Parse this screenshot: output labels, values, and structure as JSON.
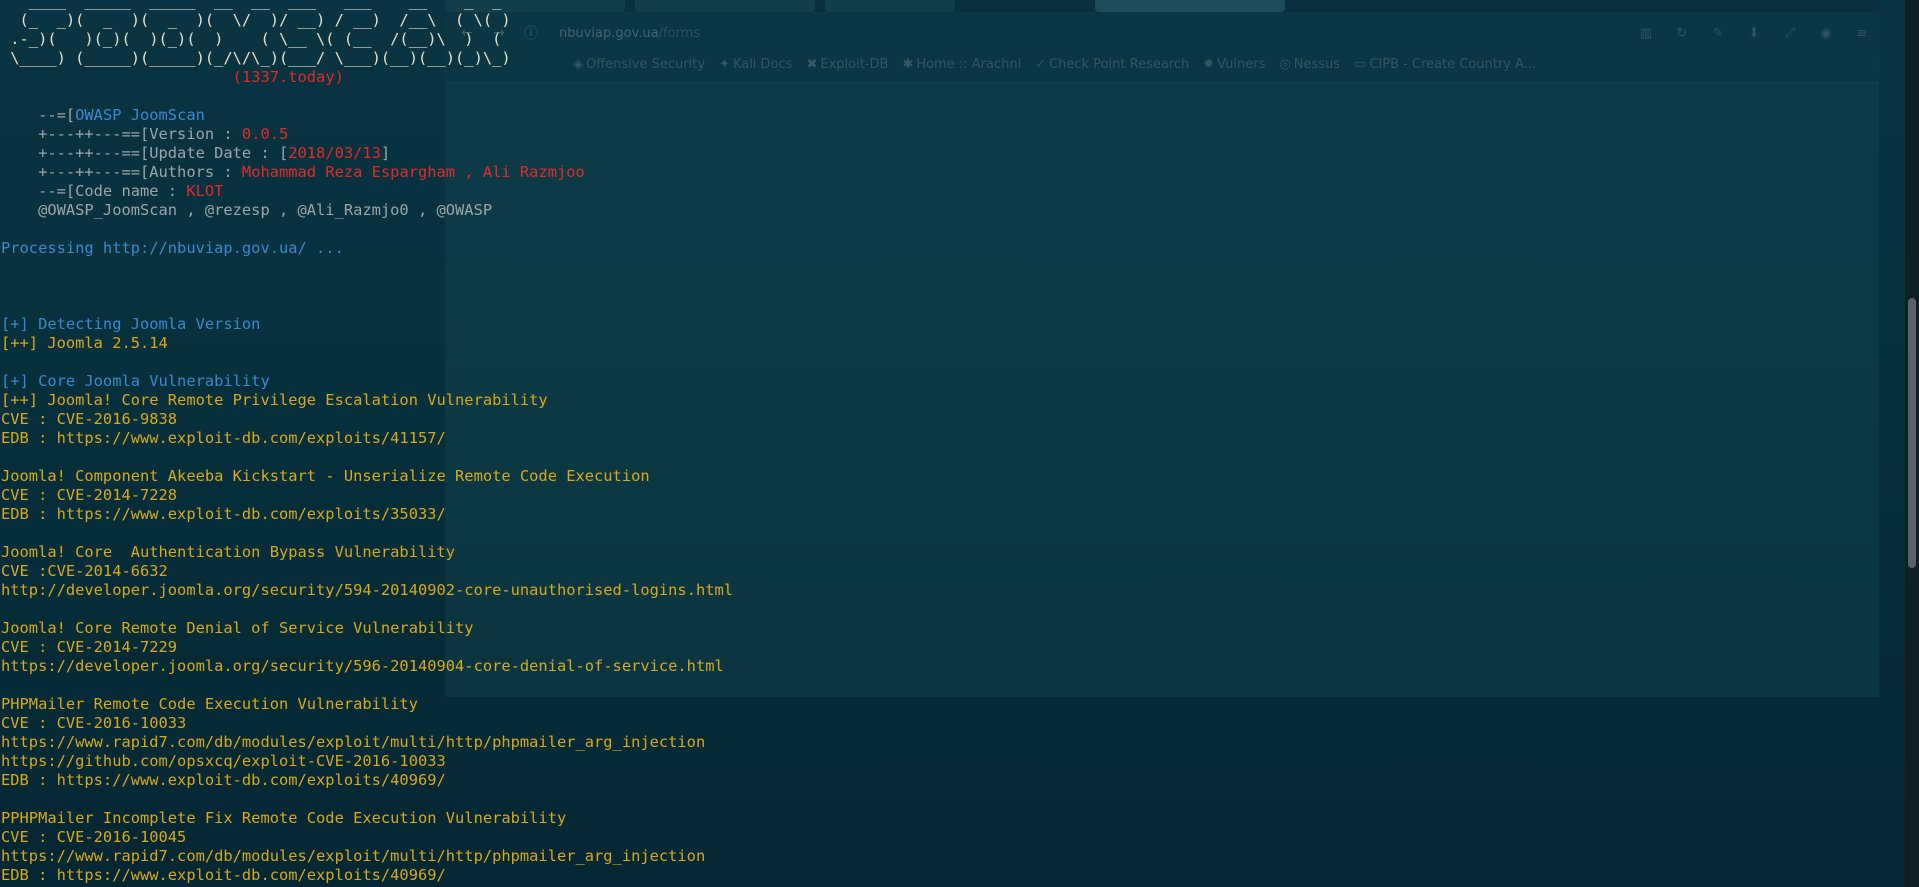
{
  "browser": {
    "url_host": "nbuviap.gov.ua",
    "url_path": "/forms",
    "bookmarks": [
      {
        "icon": "shield-icon",
        "label": "Offensive Security"
      },
      {
        "icon": "dragon-icon",
        "label": "Kali Docs"
      },
      {
        "icon": "exploit-icon",
        "label": "Exploit-DB"
      },
      {
        "icon": "spider-icon",
        "label": "Home :: Arachni"
      },
      {
        "icon": "check-icon",
        "label": "Check Point Research"
      },
      {
        "icon": "bug-icon",
        "label": "Vulners"
      },
      {
        "icon": "eye-icon",
        "label": "Nessus"
      },
      {
        "icon": "folder-icon",
        "label": "CIPB - Create Country A..."
      }
    ]
  },
  "terminal": {
    "banner_art": [
      "   ____  _____  _____  __  __  ___   ___    __    _  _ ",
      "  (_  _)(  _  )(  _  )(  \\/  )/ __) / __)  /__\\  ( \\( )",
      " .-_)(   )(_)(  )(_)(  )    ( \\__ \\( (__  /(__)\\  )  ( ",
      " \\____) (_____)(_____)(_/\\/\\_)(___/ \\___)(__)(__)(_)\\_)"
    ],
    "banner_tag": "(1337.today)",
    "tool_name_prefix": "    --=[",
    "tool_name": "OWASP JoomScan",
    "version_prefix": "    +---++---==[Version : ",
    "version": "0.0.5",
    "update_prefix": "    +---++---==[Update Date : [",
    "update_date": "2018/03/13",
    "update_suffix": "]",
    "authors_prefix": "    +---++---==[Authors : ",
    "authors": "Mohammad Reza Espargham , Ali Razmjoo",
    "codename_prefix": "    --=[Code name : ",
    "codename": "KLOT",
    "handles": "    @OWASP_JoomScan , @rezesp , @Ali_Razmjo0 , @OWASP",
    "processing": "Processing http://nbuviap.gov.ua/ ...",
    "detect_header": "[+] Detecting Joomla Version",
    "detect_result": "[++] Joomla 2.5.14",
    "core_header": "[+] Core Joomla Vulnerability",
    "vulns": [
      {
        "title": "[++] Joomla! Core Remote Privilege Escalation Vulnerability",
        "lines": [
          "CVE : CVE-2016-9838",
          "EDB : https://www.exploit-db.com/exploits/41157/"
        ]
      },
      {
        "title": "Joomla! Component Akeeba Kickstart - Unserialize Remote Code Execution",
        "lines": [
          "CVE : CVE-2014-7228",
          "EDB : https://www.exploit-db.com/exploits/35033/"
        ]
      },
      {
        "title": "Joomla! Core  Authentication Bypass Vulnerability",
        "lines": [
          "CVE :CVE-2014-6632",
          "http://developer.joomla.org/security/594-20140902-core-unauthorised-logins.html"
        ]
      },
      {
        "title": "Joomla! Core Remote Denial of Service Vulnerability",
        "lines": [
          "CVE : CVE-2014-7229",
          "https://developer.joomla.org/security/596-20140904-core-denial-of-service.html"
        ]
      },
      {
        "title": "PHPMailer Remote Code Execution Vulnerability",
        "lines": [
          "CVE : CVE-2016-10033",
          "https://www.rapid7.com/db/modules/exploit/multi/http/phpmailer_arg_injection",
          "https://github.com/opsxcq/exploit-CVE-2016-10033",
          "EDB : https://www.exploit-db.com/exploits/40969/"
        ]
      },
      {
        "title": "PPHPMailer Incomplete Fix Remote Code Execution Vulnerability",
        "lines": [
          "CVE : CVE-2016-10045",
          "https://www.rapid7.com/db/modules/exploit/multi/http/phpmailer_arg_injection",
          "EDB : https://www.exploit-db.com/exploits/40969/"
        ]
      }
    ]
  },
  "colors": {
    "background": "#06303d",
    "result_text": "#d8a91e",
    "header_text": "#3a8ad0",
    "highlight_text": "#e02b27"
  }
}
